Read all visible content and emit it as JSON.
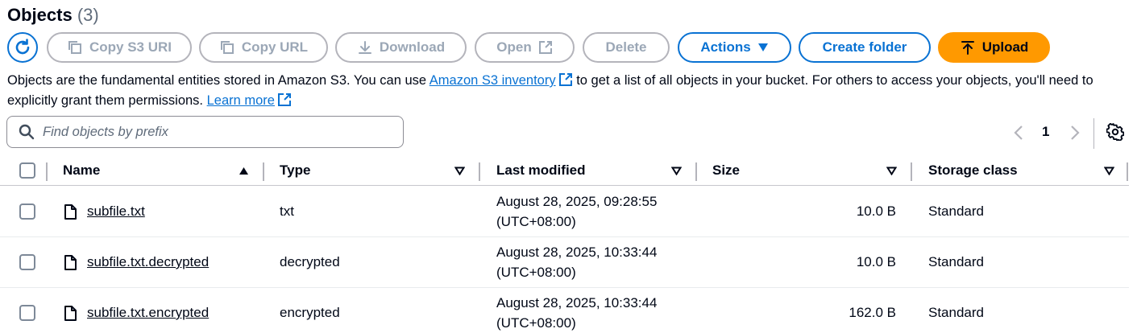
{
  "header": {
    "title": "Objects",
    "count": "(3)"
  },
  "toolbar": {
    "refresh_icon": "refresh-icon",
    "copy_s3_uri": "Copy S3 URI",
    "copy_url": "Copy URL",
    "download": "Download",
    "open": "Open",
    "delete": "Delete",
    "actions": "Actions",
    "create_folder": "Create folder",
    "upload": "Upload"
  },
  "description": {
    "part1": "Objects are the fundamental entities stored in Amazon S3. You can use ",
    "link1": "Amazon S3 inventory",
    "part2": " to get a list of all objects in your bucket. For others to access your objects, you'll need to explicitly grant them permissions. ",
    "link2": "Learn more"
  },
  "search": {
    "placeholder": "Find objects by prefix",
    "value": ""
  },
  "pagination": {
    "current_page": "1"
  },
  "table": {
    "columns": [
      "Name",
      "Type",
      "Last modified",
      "Size",
      "Storage class"
    ],
    "rows": [
      {
        "name": "subfile.txt",
        "type": "txt",
        "modified_line1": "August 28, 2025, 09:28:55",
        "modified_line2": "(UTC+08:00)",
        "size": "10.0 B",
        "storage_class": "Standard"
      },
      {
        "name": "subfile.txt.decrypted",
        "type": "decrypted",
        "modified_line1": "August 28, 2025, 10:33:44",
        "modified_line2": "(UTC+08:00)",
        "size": "10.0 B",
        "storage_class": "Standard"
      },
      {
        "name": "subfile.txt.encrypted",
        "type": "encrypted",
        "modified_line1": "August 28, 2025, 10:33:44",
        "modified_line2": "(UTC+08:00)",
        "size": "162.0 B",
        "storage_class": "Standard"
      }
    ]
  },
  "colors": {
    "accent": "#0972d3",
    "upload": "#ff9900",
    "disabled": "#9ba7b6",
    "text": "#000716"
  }
}
